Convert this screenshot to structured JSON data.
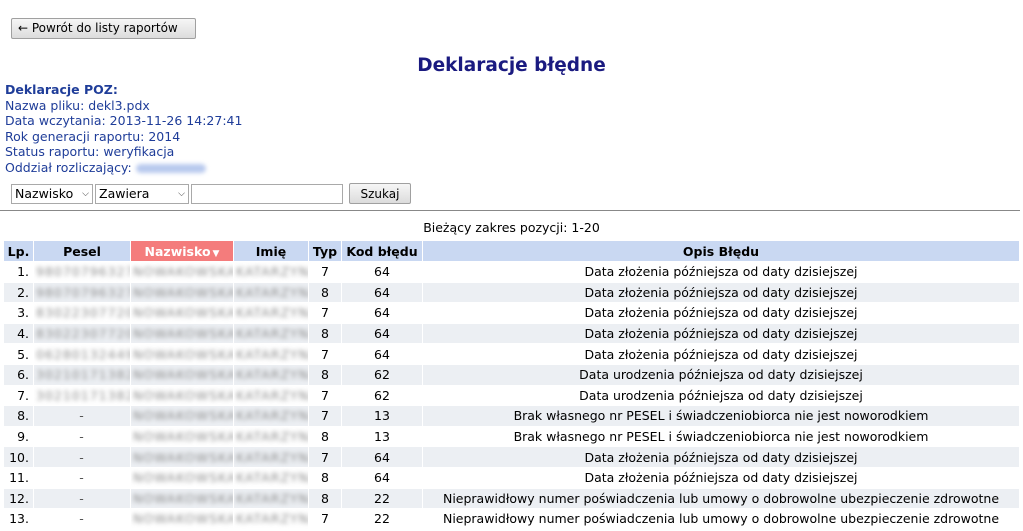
{
  "back_button": "← Powrót do listy raportów",
  "title": "Deklaracje błędne",
  "info": {
    "section": "Deklaracje POZ:",
    "file": "Nazwa pliku: dekl3.pdx",
    "loaded": "Data wczytania: 2013-11-26 14:27:41",
    "year": "Rok generacji raportu: 2014",
    "status": "Status raportu: weryfikacja",
    "branch": "Oddział rozliczający:"
  },
  "filter": {
    "field": "Nazwisko",
    "mode": "Zawiera",
    "search_value": "",
    "search_label": "Szukaj"
  },
  "range": "Bieżący zakres pozycji: 1-20",
  "columns": [
    "Lp.",
    "Pesel",
    "Nazwisko",
    "Imię",
    "Typ",
    "Kod błędu",
    "Opis Błędu"
  ],
  "sorted_column": "Nazwisko",
  "rows": [
    {
      "lp": "1.",
      "pesel": "98070796327",
      "nazwisko": "NOWAKOWSKA",
      "imie": "KATARZYNA",
      "typ": "7",
      "kod": "64",
      "opis": "Data złożenia późniejsza od daty dzisiejszej"
    },
    {
      "lp": "2.",
      "pesel": "98070796327",
      "nazwisko": "NOWAKOWSKA",
      "imie": "KATARZYNA",
      "typ": "8",
      "kod": "64",
      "opis": "Data złożenia późniejsza od daty dzisiejszej"
    },
    {
      "lp": "3.",
      "pesel": "83022307720",
      "nazwisko": "NOWAKOWSKA",
      "imie": "KATARZYNA",
      "typ": "7",
      "kod": "64",
      "opis": "Data złożenia późniejsza od daty dzisiejszej"
    },
    {
      "lp": "4.",
      "pesel": "83022307720",
      "nazwisko": "NOWAKOWSKA",
      "imie": "KATARZYNA",
      "typ": "8",
      "kod": "64",
      "opis": "Data złożenia późniejsza od daty dzisiejszej"
    },
    {
      "lp": "5.",
      "pesel": "06280132449",
      "nazwisko": "NOWAKOWSKA",
      "imie": "KATARZYNA",
      "typ": "7",
      "kod": "64",
      "opis": "Data złożenia późniejsza od daty dzisiejszej"
    },
    {
      "lp": "6.",
      "pesel": "30210171382",
      "nazwisko": "NOWAKOWSKA",
      "imie": "KATARZYNA",
      "typ": "8",
      "kod": "62",
      "opis": "Data urodzenia późniejsza od daty dzisiejszej"
    },
    {
      "lp": "7.",
      "pesel": "30210171382",
      "nazwisko": "NOWAKOWSKA",
      "imie": "KATARZYNA",
      "typ": "7",
      "kod": "62",
      "opis": "Data urodzenia późniejsza od daty dzisiejszej"
    },
    {
      "lp": "8.",
      "pesel": "-",
      "nazwisko": "NOWAKOWSKA",
      "imie": "KATARZYNA",
      "typ": "7",
      "kod": "13",
      "opis": "Brak własnego nr PESEL i świadczeniobiorca nie jest noworodkiem"
    },
    {
      "lp": "9.",
      "pesel": "-",
      "nazwisko": "NOWAKOWSKA",
      "imie": "KATARZYNA",
      "typ": "8",
      "kod": "13",
      "opis": "Brak własnego nr PESEL i świadczeniobiorca nie jest noworodkiem"
    },
    {
      "lp": "10.",
      "pesel": "-",
      "nazwisko": "NOWAKOWSKA",
      "imie": "KATARZYNA",
      "typ": "7",
      "kod": "64",
      "opis": "Data złożenia późniejsza od daty dzisiejszej"
    },
    {
      "lp": "11.",
      "pesel": "-",
      "nazwisko": "NOWAKOWSKA",
      "imie": "KATARZYNA",
      "typ": "8",
      "kod": "64",
      "opis": "Data złożenia późniejsza od daty dzisiejszej"
    },
    {
      "lp": "12.",
      "pesel": "-",
      "nazwisko": "NOWAKOWSKA",
      "imie": "KATARZYNA",
      "typ": "8",
      "kod": "22",
      "opis": "Nieprawidłowy numer poświadczenia lub umowy o dobrowolne ubezpieczenie zdrowotne"
    },
    {
      "lp": "13.",
      "pesel": "-",
      "nazwisko": "NOWAKOWSKA",
      "imie": "KATARZYNA",
      "typ": "7",
      "kod": "22",
      "opis": "Nieprawidłowy numer poświadczenia lub umowy o dobrowolne ubezpieczenie zdrowotne"
    }
  ],
  "colors": {
    "title": "#1a1a80",
    "info_text": "#1f3d99",
    "header_bg": "#c9d8f2",
    "sorted_header_bg": "#f47c7c",
    "row_alt_bg": "#eceff3"
  }
}
